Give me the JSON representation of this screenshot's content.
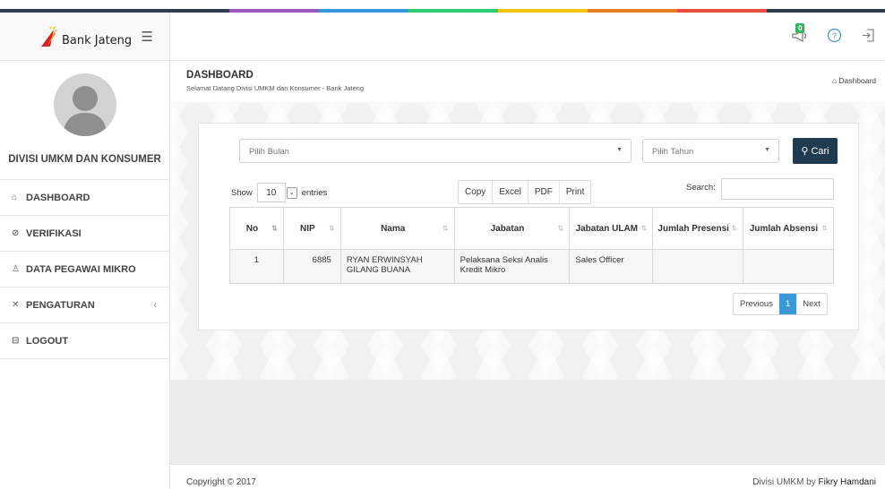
{
  "brand": {
    "name": "Bank Jateng"
  },
  "sidebar": {
    "user_name": "DIVISI UMKM DAN KONSUMER",
    "items": [
      {
        "label": "DASHBOARD",
        "icon": "home-icon"
      },
      {
        "label": "VERIFIKASI",
        "icon": "check-circle-icon"
      },
      {
        "label": "DATA PEGAWAI MIKRO",
        "icon": "users-icon"
      },
      {
        "label": "PENGATURAN",
        "icon": "tools-icon"
      },
      {
        "label": "LOGOUT",
        "icon": "logout-icon"
      }
    ]
  },
  "topbar": {
    "notification_count": "0"
  },
  "page": {
    "title": "DASHBOARD",
    "subtitle": "Selamat Datang Divisi UMKM dan Konsumer - Bank Jateng",
    "breadcrumb": "Dashboard"
  },
  "filter": {
    "month_placeholder": "Pilih Bulan",
    "year_placeholder": "Pilih Tahun",
    "search_button": "Cari"
  },
  "table_controls": {
    "show_label": "Show",
    "entries_value": "10",
    "entries_label": "entries",
    "export_buttons": [
      "Copy",
      "Excel",
      "PDF",
      "Print"
    ],
    "search_label": "Search:"
  },
  "table": {
    "headers": [
      "No",
      "NIP",
      "Nama",
      "Jabatan",
      "Jabatan ULAM",
      "Jumlah Presensi",
      "Jumlah Absensi"
    ],
    "rows": [
      [
        "1",
        "6885",
        "RYAN ERWINSYAH GILANG BUANA",
        "Pelaksana Seksi Analis Kredit Mikro",
        "Sales Officer",
        "",
        ""
      ]
    ]
  },
  "pagination": {
    "previous": "Previous",
    "current": "1",
    "next": "Next"
  },
  "footer": {
    "copyright": "Copyright © 2017",
    "credit_prefix": "Divisi UMKM by ",
    "credit_name": "Fikry Hamdani"
  },
  "colors": {
    "accent_dark": "#1f3b52",
    "page_active": "#3a98d8",
    "rainbow": [
      "#2d3e50",
      "#9b59b6",
      "#3498db",
      "#2ecc71",
      "#f1c40f",
      "#e67e22",
      "#e74c3c",
      "#2d3e50"
    ]
  }
}
